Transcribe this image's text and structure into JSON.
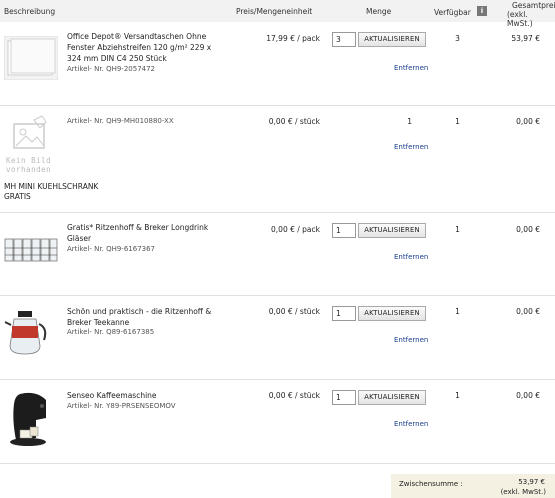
{
  "header": {
    "description": "Beschreibung",
    "unit_price": "Preis/Mengeneinheit",
    "quantity": "Menge",
    "availability": "Verfügbar",
    "info_icon": "i",
    "total_line1": "Gesamtpreis",
    "total_line2": "(exkl. MwSt.)"
  },
  "items": [
    {
      "name": "Office Depot® Versandtaschen Ohne Fenster Abziehstreifen 120 g/m² 229 x 324 mm DIN C4 250 Stück",
      "article": "Artikel- Nr.  QH9-2057472",
      "price": "17,99 € / pack",
      "quantity": "3",
      "update": "AKTUALISIEREN",
      "remove": "Entfernen",
      "available": "3",
      "total": "53,97 €"
    },
    {
      "name": "",
      "article": "Artikel- Nr.  QH9-MH010880-XX",
      "price": "0,00 € / stück",
      "quantity": "1",
      "remove": "Entfernen",
      "available": "1",
      "total": "0,00 €",
      "placeholder_line1": "Kein Bild",
      "placeholder_line2": "vorhanden",
      "extra_line1": "MH MINI KUEHLSCHRANK",
      "extra_line2": "GRATIS"
    },
    {
      "name": "Gratis* Ritzenhoff & Breker Longdrink Gläser",
      "article": "Artikel- Nr.  QH9-6167367",
      "price": "0,00 € / pack",
      "quantity": "1",
      "update": "AKTUALISIEREN",
      "remove": "Entfernen",
      "available": "1",
      "total": "0,00 €"
    },
    {
      "name": "Schön und praktisch - die Ritzenhoff & Breker Teekanne",
      "article": "Artikel- Nr.  Q89-6167385",
      "price": "0,00 € / stück",
      "quantity": "1",
      "update": "AKTUALISIEREN",
      "remove": "Entfernen",
      "available": "1",
      "total": "0,00 €"
    },
    {
      "name": "Senseo Kaffeemaschine",
      "article": "Artikel- Nr.  Y89-PRSENSEOMOV",
      "price": "0,00 € / stück",
      "quantity": "1",
      "update": "AKTUALISIEREN",
      "remove": "Entfernen",
      "available": "1",
      "total": "0,00 €"
    }
  ],
  "subtotal": {
    "label": "Zwischensumme :",
    "value": "53,97 €",
    "note": "(exkl. MwSt.)"
  },
  "colors": {
    "link": "#1a3e8c",
    "header_bg": "#f2f2f2",
    "subtotal_bg": "#f4f1e3"
  }
}
